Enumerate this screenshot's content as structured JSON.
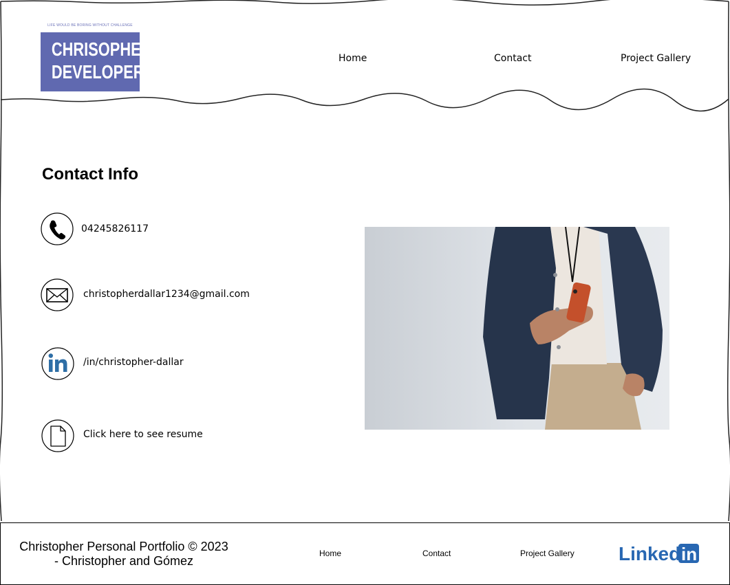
{
  "header": {
    "logo": {
      "tagline": "LIFE WOULD BE BORING WITHOUT CHALLENGE",
      "line1": "CHRISOPHER",
      "line2": "DEVELOPER",
      "color": "#6069b0"
    },
    "nav": [
      {
        "label": "Home"
      },
      {
        "label": "Contact"
      },
      {
        "label": "Project Gallery"
      }
    ]
  },
  "main": {
    "title": "Contact Info",
    "items": [
      {
        "icon": "phone-icon",
        "text": "04245826117"
      },
      {
        "icon": "envelope-icon",
        "text": "christopherdallar1234@gmail.com"
      },
      {
        "icon": "linkedin-icon",
        "text": "/in/christopher-dallar"
      },
      {
        "icon": "document-icon",
        "text": "Click here to see resume"
      }
    ],
    "photo": "person holding orange phone"
  },
  "footer": {
    "copyright_line1": "Christopher Personal Portfolio © 2023",
    "copyright_line2": "- Christopher and Gómez",
    "nav": [
      {
        "label": "Home"
      },
      {
        "label": "Contact"
      },
      {
        "label": "Project Gallery"
      }
    ],
    "linkedin_word": "Linked",
    "linkedin_in": "in",
    "linkedin_color": "#2867b2"
  }
}
